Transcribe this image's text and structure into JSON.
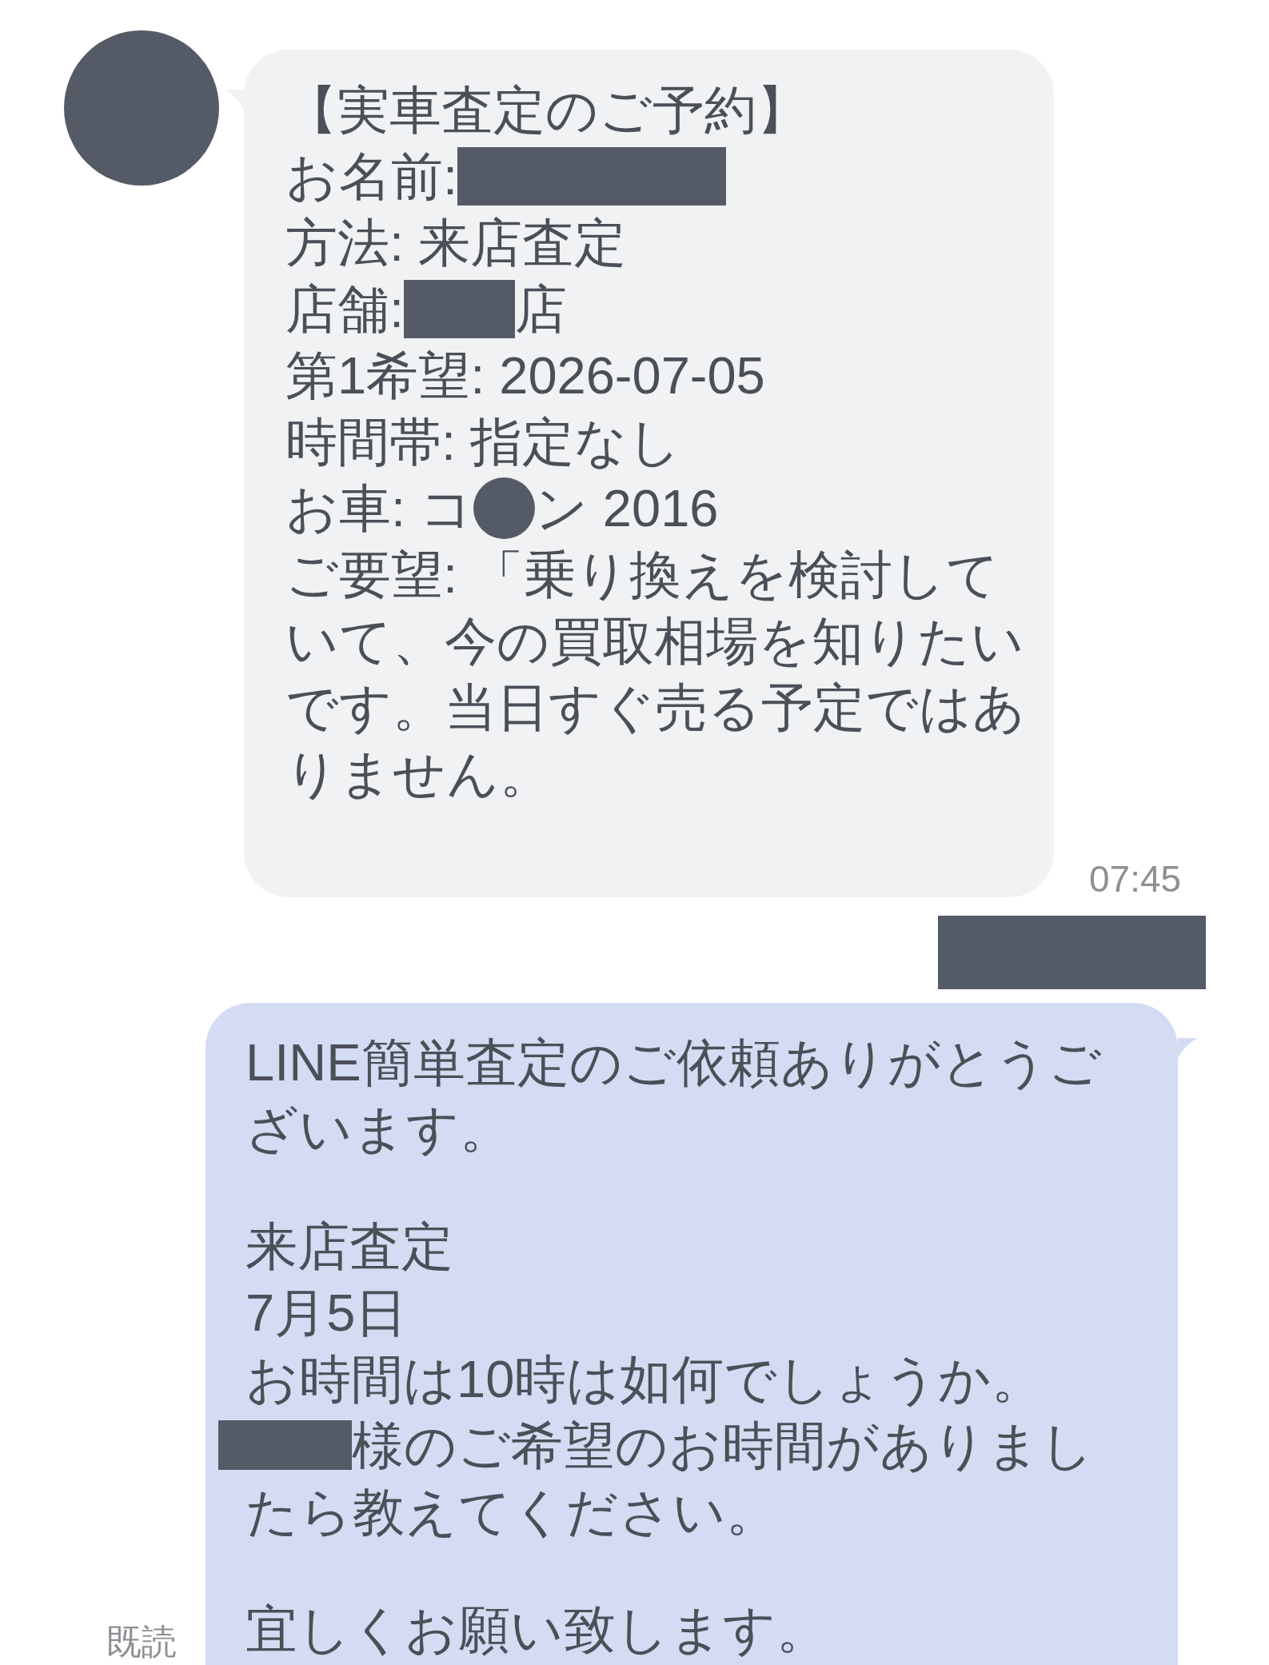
{
  "messages": [
    {
      "kind": "received",
      "paragraphs": [
        [
          [
            {
              "kind": "text",
              "text": "【実車査定のご予約】"
            }
          ],
          [
            {
              "kind": "text",
              "text": "お名前:"
            },
            {
              "kind": "longbar"
            }
          ],
          [
            {
              "kind": "text",
              "text": "方法: 来店査定"
            }
          ],
          [
            {
              "kind": "text",
              "text": "店舗:"
            },
            {
              "kind": "shortbar"
            },
            {
              "kind": "text",
              "text": "店"
            }
          ],
          [
            {
              "kind": "text",
              "text": "第1希望: 2026-07-05"
            }
          ],
          [
            {
              "kind": "text",
              "text": "時間帯: 指定なし"
            }
          ],
          [
            {
              "kind": "text",
              "text": "お車: コ"
            },
            {
              "kind": "dot"
            },
            {
              "kind": "text",
              "text": "ン 2016"
            }
          ],
          [
            {
              "kind": "text",
              "text": "ご要望: 「乗り換えを検討していて、今の買取相場を知りたいです。当日すぐ売る予定ではありません。"
            }
          ]
        ]
      ],
      "time": "07:45"
    },
    {
      "kind": "redaction"
    },
    {
      "kind": "sent",
      "read_label": "既読",
      "paragraphs": [
        [
          [
            {
              "kind": "text",
              "text": "LINE簡単査定のご依頼ありがとうございます。"
            }
          ]
        ],
        [
          [
            {
              "kind": "text",
              "text": "来店査定"
            }
          ],
          [
            {
              "kind": "text",
              "text": "7月5日"
            }
          ],
          [
            {
              "kind": "text",
              "text": "お時間は10時は如何でしょうか。"
            }
          ],
          [
            {
              "kind": "midbar"
            },
            {
              "kind": "text",
              "text": "様のご希望のお時間がありまし"
            }
          ],
          [
            {
              "kind": "text",
              "text": "たら教えてください。"
            }
          ]
        ],
        [
          [
            {
              "kind": "text",
              "text": "宜しくお願い致します。"
            }
          ]
        ]
      ]
    }
  ]
}
